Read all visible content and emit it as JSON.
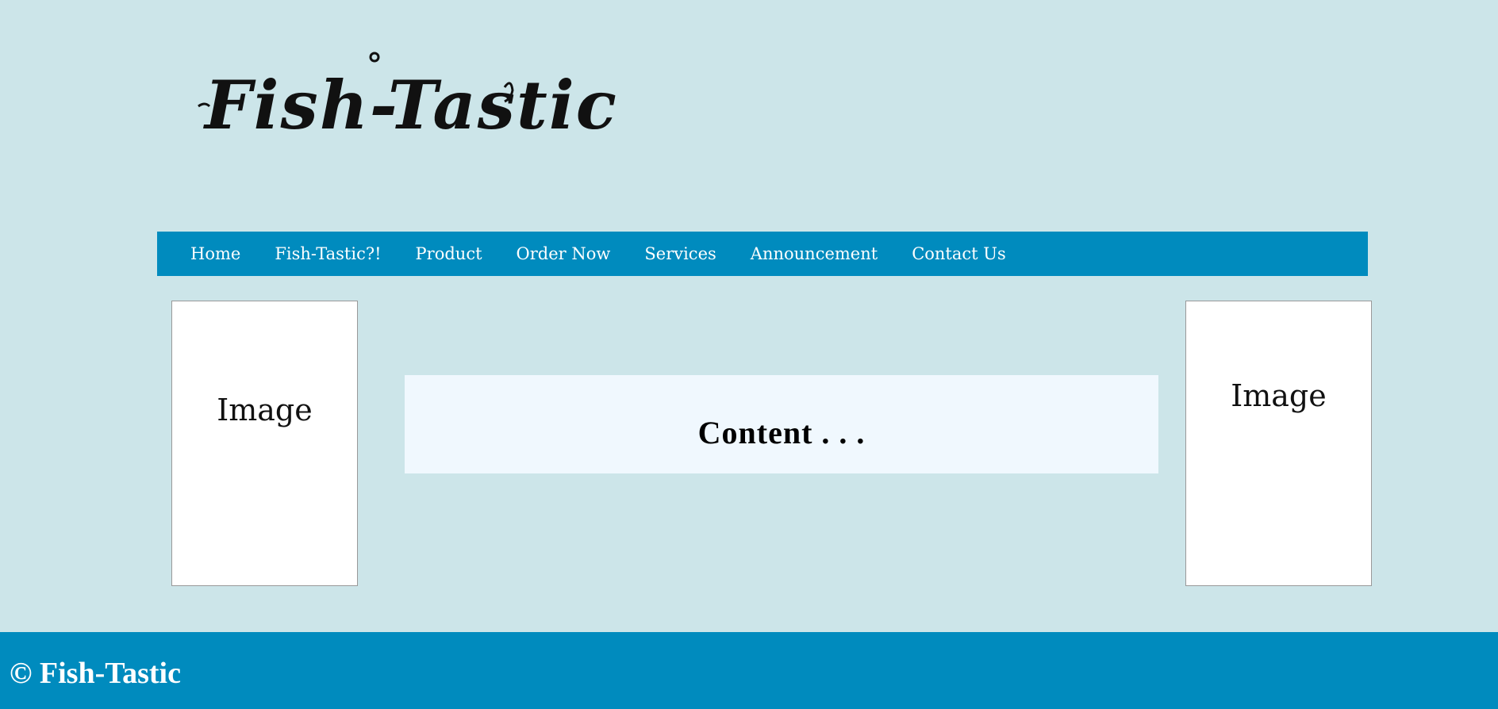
{
  "logo": {
    "text": "Fish-Tastic"
  },
  "nav": {
    "items": [
      {
        "label": "Home"
      },
      {
        "label": "Fish-Tastic?!"
      },
      {
        "label": "Product"
      },
      {
        "label": "Order Now"
      },
      {
        "label": "Services"
      },
      {
        "label": "Announcement"
      },
      {
        "label": "Contact Us"
      }
    ]
  },
  "left_image": {
    "label": "Image"
  },
  "right_image": {
    "label": "Image"
  },
  "content": {
    "text": "Content . . ."
  },
  "footer": {
    "text": "© Fish-Tastic"
  },
  "colors": {
    "background": "#cce5e9",
    "nav_background": "#008bbe",
    "content_background": "#f0f8fe",
    "footer_background": "#008bbe"
  }
}
